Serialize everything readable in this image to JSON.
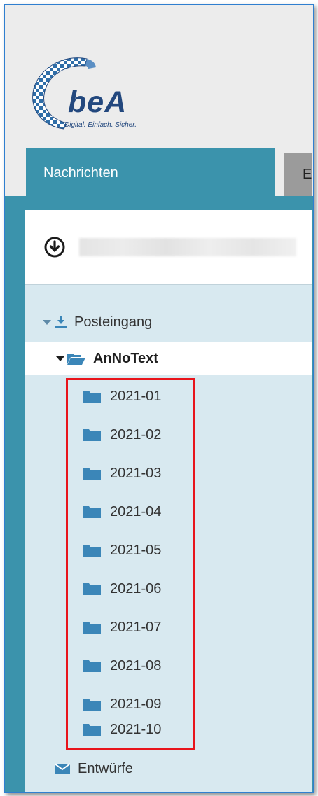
{
  "logo": {
    "text": "beA",
    "tagline": "Digital. Einfach. Sicher."
  },
  "tabs": [
    {
      "label": "Nachrichten",
      "active": true
    },
    {
      "label": "E",
      "active": false
    }
  ],
  "account": {
    "icon": "download-circle-icon"
  },
  "tree": {
    "inbox": {
      "label": "Posteingang",
      "icon": "inbox-download-icon",
      "expanded": true
    },
    "group": {
      "label": "AnNoText",
      "icon": "folder-open-icon",
      "expanded": true
    },
    "folders": [
      "2021-01",
      "2021-02",
      "2021-03",
      "2021-04",
      "2021-05",
      "2021-06",
      "2021-07",
      "2021-08",
      "2021-09",
      "2021-10"
    ],
    "drafts": {
      "label": "Entwürfe",
      "icon": "envelope-icon"
    }
  },
  "colors": {
    "accent": "#3b93ac",
    "panel": "#d8e9f0",
    "highlight": "#e8141b",
    "brand": "#23487e"
  }
}
